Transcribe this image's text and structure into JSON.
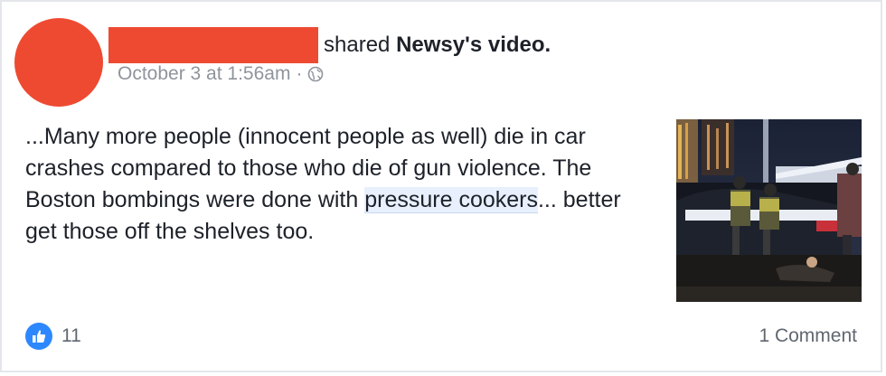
{
  "post": {
    "header": {
      "action_text": "shared",
      "page_name": "Newsy's",
      "object_text": "video."
    },
    "meta": {
      "timestamp": "October 3 at 1:56am",
      "separator": "·",
      "audience_icon": "globe-icon"
    },
    "body": {
      "text_before": "...Many more people (innocent people as well) die in car crashes compared to those who die of gun violence. The Boston bombings were done with ",
      "highlighted": "pressure cookers",
      "text_after": "... better get those off the shelves too."
    },
    "footer": {
      "reactions_count": "11",
      "comments_label": "1 Comment"
    },
    "colors": {
      "redaction": "#ee4a32",
      "like_blue": "#2d88ff",
      "meta_gray": "#90949c"
    }
  }
}
